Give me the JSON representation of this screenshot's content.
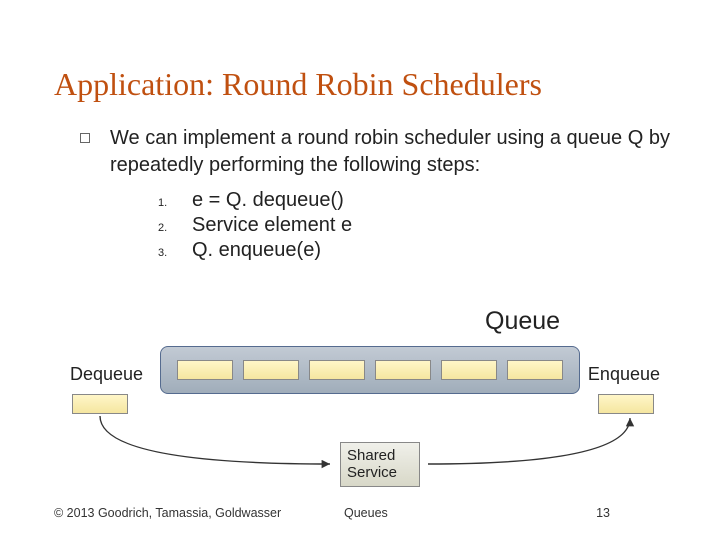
{
  "title": "Application: Round Robin Schedulers",
  "intro": "We can implement a round robin scheduler using a queue Q by repeatedly performing the following steps:",
  "steps": [
    {
      "n": "1.",
      "text": "e = Q. dequeue()"
    },
    {
      "n": "2.",
      "text": "Service element e"
    },
    {
      "n": "3.",
      "text": "Q. enqueue(e)"
    }
  ],
  "labels": {
    "queue": "Queue",
    "dequeue": "Dequeue",
    "enqueue": "Enqueue",
    "shared_line1": "Shared",
    "shared_line2": "Service"
  },
  "footer": {
    "copyright": "© 2013 Goodrich, Tamassia, Goldwasser",
    "topic": "Queues",
    "page": "13"
  },
  "chart_data": {
    "type": "diagram",
    "description": "Round robin scheduler cycle",
    "queue_slot_count": 6,
    "flow": [
      "Dequeue from front",
      "Shared Service",
      "Enqueue to back"
    ]
  }
}
